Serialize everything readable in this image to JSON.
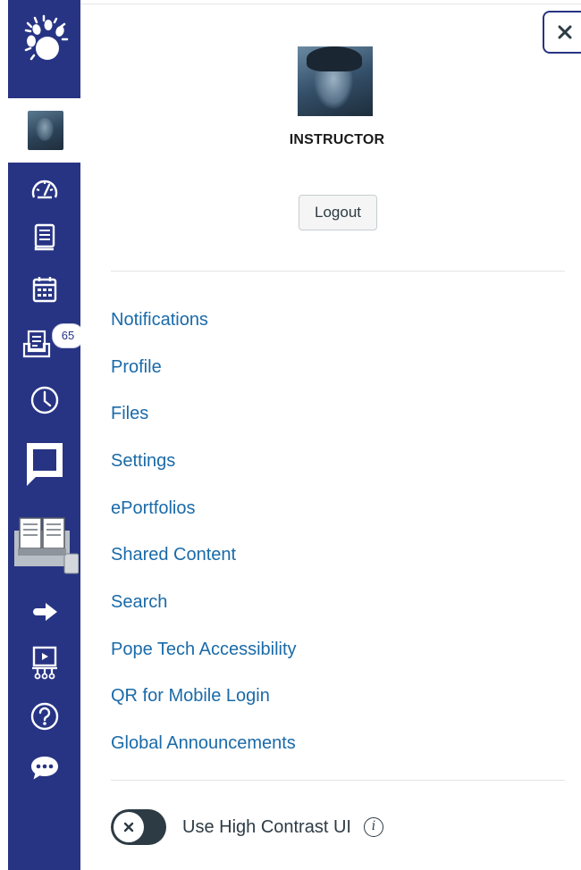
{
  "global_nav": {
    "badge_count": "65",
    "background": "#273484",
    "icons": [
      "paw-logo-icon",
      "avatar",
      "dashboard-icon",
      "courses-icon",
      "calendar-icon",
      "inbox-icon",
      "history-icon",
      "chat-icon",
      "library-icon",
      "commons-icon",
      "studio-icon",
      "help-icon",
      "feedback-icon"
    ]
  },
  "tray": {
    "user_name": "INSTRUCTOR",
    "logout_label": "Logout",
    "menu_items": [
      {
        "label": "Notifications"
      },
      {
        "label": "Profile"
      },
      {
        "label": "Files"
      },
      {
        "label": "Settings"
      },
      {
        "label": "ePortfolios"
      },
      {
        "label": "Shared Content"
      },
      {
        "label": "Search"
      },
      {
        "label": "Pope Tech Accessibility"
      },
      {
        "label": "QR for Mobile Login"
      },
      {
        "label": "Global Announcements"
      }
    ],
    "high_contrast_label": "Use High Contrast UI",
    "high_contrast_enabled": false,
    "link_color": "#1a6aa8"
  }
}
